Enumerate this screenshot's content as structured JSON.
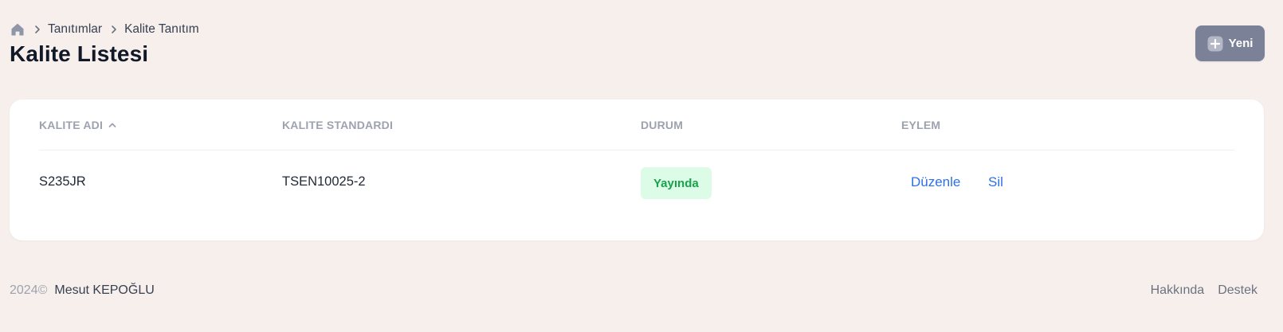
{
  "breadcrumb": {
    "home_icon": "home-icon",
    "items": [
      {
        "label": "Tanıtımlar"
      },
      {
        "label": "Kalite Tanıtım"
      }
    ]
  },
  "page": {
    "title": "Kalite Listesi"
  },
  "toolbar": {
    "new_label": "Yeni",
    "new_icon": "plus-square-icon"
  },
  "table": {
    "columns": [
      {
        "label": "KALITE ADI",
        "sorted": "ascending"
      },
      {
        "label": "KALITE STANDARDI"
      },
      {
        "label": "DURUM"
      },
      {
        "label": "EYLEM"
      }
    ],
    "rows": [
      {
        "name": "S235JR",
        "standard": "TSEN10025-2",
        "status": "Yayında",
        "actions": [
          "Düzenle",
          "Sil"
        ]
      }
    ]
  },
  "footer": {
    "year": "2024©",
    "author": "Mesut KEPOĞLU",
    "links": [
      "Hakkında",
      "Destek"
    ]
  },
  "colors": {
    "background": "#f7efec",
    "primary_button": "#7b8196",
    "link": "#2f6fe4",
    "status_bg": "#dcfce7",
    "status_text": "#16a34a"
  }
}
